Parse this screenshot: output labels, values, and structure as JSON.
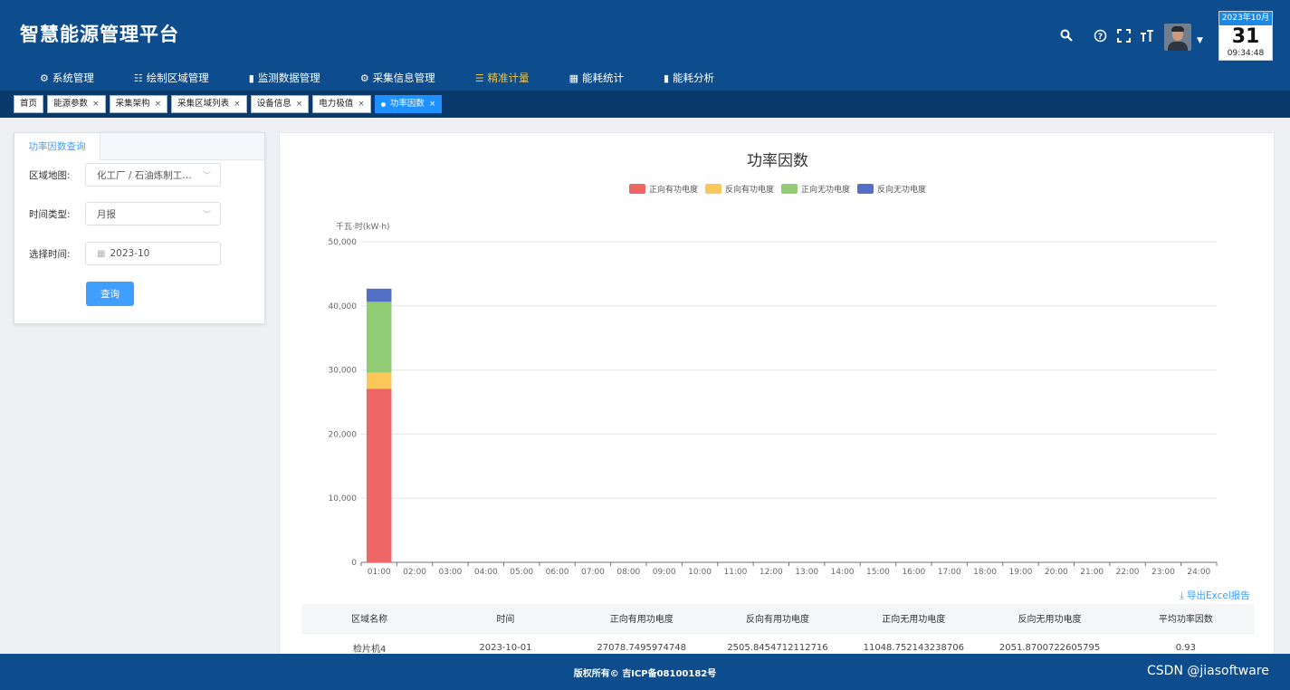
{
  "header": {
    "title": "智慧能源管理平台",
    "nav": [
      {
        "icon": "gear-icon",
        "glyph": "⚙",
        "label": "系统管理"
      },
      {
        "icon": "document-icon",
        "glyph": "☷",
        "label": "绘制区域管理"
      },
      {
        "icon": "bar-chart-icon",
        "glyph": "▮",
        "label": "监测数据管理"
      },
      {
        "icon": "cog-icon",
        "glyph": "⚙",
        "label": "采集信息管理"
      },
      {
        "icon": "sliders-icon",
        "glyph": "☰",
        "label": "精准计量",
        "active": true
      },
      {
        "icon": "calculator-icon",
        "glyph": "▦",
        "label": "能耗统计"
      },
      {
        "icon": "bar-chart-icon",
        "glyph": "▮",
        "label": "能耗分析"
      }
    ],
    "calendar": {
      "month": "2023年10月",
      "day": "31",
      "time": "09:34:48"
    }
  },
  "tabs": [
    {
      "label": "首页",
      "closable": false
    },
    {
      "label": "能源参数",
      "closable": true
    },
    {
      "label": "采集架构",
      "closable": true
    },
    {
      "label": "采集区域列表",
      "closable": true
    },
    {
      "label": "设备信息",
      "closable": true
    },
    {
      "label": "电力极值",
      "closable": true
    },
    {
      "label": "功率因数",
      "closable": true,
      "active": true
    }
  ],
  "query_panel": {
    "tab_label": "功率因数查询",
    "area_label": "区域地图:",
    "area_value": "化工厂 / 石油炼制工业...",
    "time_type_label": "时间类型:",
    "time_type_value": "月报",
    "date_label": "选择时间:",
    "date_value": "2023-10",
    "query_button": "查询"
  },
  "chart_data": {
    "type": "bar",
    "stacked": true,
    "title": "功率因数",
    "ylabel": "千瓦·时(kW·h)",
    "ylim": [
      0,
      50000
    ],
    "yticks": [
      "0",
      "10,000",
      "20,000",
      "30,000",
      "40,000",
      "50,000"
    ],
    "categories": [
      "01:00",
      "02:00",
      "03:00",
      "04:00",
      "05:00",
      "06:00",
      "07:00",
      "08:00",
      "09:00",
      "10:00",
      "11:00",
      "12:00",
      "13:00",
      "14:00",
      "15:00",
      "16:00",
      "17:00",
      "18:00",
      "19:00",
      "20:00",
      "21:00",
      "22:00",
      "23:00",
      "24:00"
    ],
    "grid": true,
    "legend_position": "top-center",
    "series": [
      {
        "name": "正向有功电度",
        "color": "#ee6666",
        "values": [
          27078.75,
          0,
          0,
          0,
          0,
          0,
          0,
          0,
          0,
          0,
          0,
          0,
          0,
          0,
          0,
          0,
          0,
          0,
          0,
          0,
          0,
          0,
          0,
          0
        ]
      },
      {
        "name": "反向有功电度",
        "color": "#fac858",
        "values": [
          2505.85,
          0,
          0,
          0,
          0,
          0,
          0,
          0,
          0,
          0,
          0,
          0,
          0,
          0,
          0,
          0,
          0,
          0,
          0,
          0,
          0,
          0,
          0,
          0
        ]
      },
      {
        "name": "正向无功电度",
        "color": "#91cc75",
        "values": [
          11048.75,
          0,
          0,
          0,
          0,
          0,
          0,
          0,
          0,
          0,
          0,
          0,
          0,
          0,
          0,
          0,
          0,
          0,
          0,
          0,
          0,
          0,
          0,
          0
        ]
      },
      {
        "name": "反向无功电度",
        "color": "#5470c6",
        "values": [
          2051.87,
          0,
          0,
          0,
          0,
          0,
          0,
          0,
          0,
          0,
          0,
          0,
          0,
          0,
          0,
          0,
          0,
          0,
          0,
          0,
          0,
          0,
          0,
          0
        ]
      }
    ]
  },
  "export_label": "⤓ 导出Excel报告",
  "table": {
    "headers": [
      "区域名称",
      "时间",
      "正向有用功电度",
      "反向有用功电度",
      "正向无用功电度",
      "反向无用功电度",
      "平均功率因数"
    ],
    "rows": [
      [
        "检片机4",
        "2023-10-01",
        "27078.7495974748",
        "2505.8454712112716",
        "11048.752143238706",
        "2051.8700722605795",
        "0.93"
      ]
    ]
  },
  "footer": {
    "copyright": "版权所有© 吉ICP备08100182号",
    "watermark": "CSDN @jiasoftware"
  }
}
